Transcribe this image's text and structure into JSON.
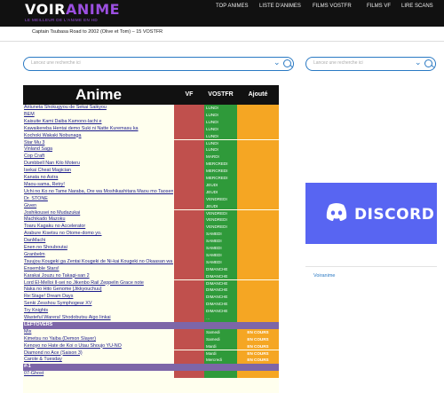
{
  "header": {
    "logo_main": "VOIR",
    "logo_accent": "ANIME",
    "logo_sub": "LE MEILLEUR DE L'ANIME EN HD",
    "nav": [
      "TOP ANIMES",
      "LISTE D'ANIMES",
      "FILMS VOSTFR",
      "FILMS VF",
      "LIRE SCANS"
    ]
  },
  "ticker": {
    "text": "Captain Tsubasa Road to 2002 (Olive et Tom) – 15 VOSTFR"
  },
  "search_main": {
    "placeholder": "Lancez une recherche ici"
  },
  "search_side": {
    "placeholder": "Lancez une recherche ici"
  },
  "table": {
    "headers": {
      "anime": "Anime",
      "vf": "VF",
      "vostfr": "VOSTFR",
      "ajoute": "Ajouté"
    },
    "rows": [
      {
        "title": "Ariiuneta Shokugyou de Sekai Saikyou",
        "vostfr": "LUNDI",
        "ajoute": ""
      },
      {
        "title": "BEM",
        "vostfr": "LUNDI",
        "ajoute": ""
      },
      {
        "title": "Kaisuite Kami Daiba Kamono-lachi e",
        "vostfr": "LUNDI",
        "ajoute": ""
      },
      {
        "title": "Kawaikereba Hentai demo Suki ni Natte Kuremasu ka",
        "vostfr": "LUNDI",
        "ajoute": ""
      },
      {
        "title": "Kochoki Wakaki Nobunaga",
        "vostfr": "LUNDI",
        "ajoute": ""
      },
      {
        "title": "Star Mu 3",
        "vostfr": "LUNDI",
        "ajoute": ""
      },
      {
        "title": "Vinland Saga",
        "vostfr": "LUNDI",
        "ajoute": ""
      },
      {
        "title": "Cop Craft",
        "vostfr": "MARDI",
        "ajoute": ""
      },
      {
        "title": "Dumbbell Nan Kilo Moteru",
        "vostfr": "MERCREDI",
        "ajoute": ""
      },
      {
        "title": "Isekai Cheat Magician",
        "vostfr": "MERCREDI",
        "ajoute": ""
      },
      {
        "title": "Kanata no Astra",
        "vostfr": "MERCREDI",
        "ajoute": ""
      },
      {
        "title": "Maou-sama, Retry!",
        "vostfr": "JEUDI",
        "ajoute": ""
      },
      {
        "title": "Uchi no Ko no Tame Naraba, Ore wa Moshikashitara Maou mo Taoseru Kamo",
        "vostfr": "JEUDI",
        "ajoute": ""
      },
      {
        "title": "Dr. STONE",
        "vostfr": "VENDREDI",
        "ajoute": ""
      },
      {
        "title": "Given",
        "vostfr": "JEUDI",
        "ajoute": ""
      },
      {
        "title": "Joshikousei no Mudazukai",
        "vostfr": "VENDREDI",
        "ajoute": ""
      },
      {
        "title": "Machikado Mazoku",
        "vostfr": "VENDREDI",
        "ajoute": ""
      },
      {
        "title": "Toaru Kagaku no Accelerator",
        "vostfr": "VENDREDI",
        "ajoute": ""
      },
      {
        "title": "Arabure Kisetsu no Otome-domo yo.",
        "vostfr": "SAMEDI",
        "ajoute": ""
      },
      {
        "title": "DanMachi",
        "vostfr": "SAMEDI",
        "ajoute": ""
      },
      {
        "title": "Enen no Shouboutai",
        "vostfr": "SAMEDI",
        "ajoute": ""
      },
      {
        "title": "Granbelm",
        "vostfr": "SAMEDI",
        "ajoute": ""
      },
      {
        "title": "Tsuujou Kougeki ga Zentai Kougeki de Ni-kai Kougeki no Okaasan wa Suki desu ka?",
        "vostfr": "SAMEDI",
        "ajoute": ""
      },
      {
        "title": "Ensemble Stars!",
        "vostfr": "DIMANCHE",
        "ajoute": ""
      },
      {
        "title": "Karakai Jouzu no Takagi-san 2",
        "vostfr": "DIMANCHE",
        "ajoute": ""
      },
      {
        "title": "Lord El-Melloi II-sei no Jikenbo Rail Zeppelin Grace note",
        "vostfr": "DIMANCHE",
        "ajoute": ""
      },
      {
        "title": "Naka no Hito Genome [Jikkyouchuu]",
        "vostfr": "DIMANCHE",
        "ajoute": ""
      },
      {
        "title": "Re:Stage! Dream Days",
        "vostfr": "DIMANCHE",
        "ajoute": ""
      },
      {
        "title": "Senki Zesshou Symphogear XV",
        "vostfr": "DIMANCHE",
        "ajoute": ""
      },
      {
        "title": "Try Knights",
        "vostfr": "DIMANCHE",
        "ajoute": ""
      },
      {
        "title": "Wasteful Warera! Shodobutsu Aigo Iinkai",
        "vostfr": "…",
        "ajoute": ""
      },
      {
        "title": "LEFTOVERS",
        "section": true
      },
      {
        "title": "Mix",
        "vostfr": "Samedi",
        "ajoute": "EN COURS"
      },
      {
        "title": "Kimetsu no Yaiba (Demon Slayer)",
        "vostfr": "Samedi",
        "ajoute": "EN COURS"
      },
      {
        "title": "Kenoyo no Hate de Koi o Utau Shoujo YU-NO",
        "vostfr": "Mardi",
        "ajoute": "EN COURS"
      },
      {
        "title": "Diamond no Ace (Saison 3)",
        "vostfr": "Mardi",
        "ajoute": "EN COURS"
      },
      {
        "title": "Carole & Tuesday",
        "vostfr": "Mercredi",
        "ajoute": "EN COURS"
      },
      {
        "title": "#-1",
        "section": true
      },
      {
        "title": "07-Ghost",
        "vostfr": "",
        "ajoute": ""
      }
    ]
  },
  "sidebar": {
    "discord_label": "DISCORD",
    "link": "Voiranime"
  }
}
